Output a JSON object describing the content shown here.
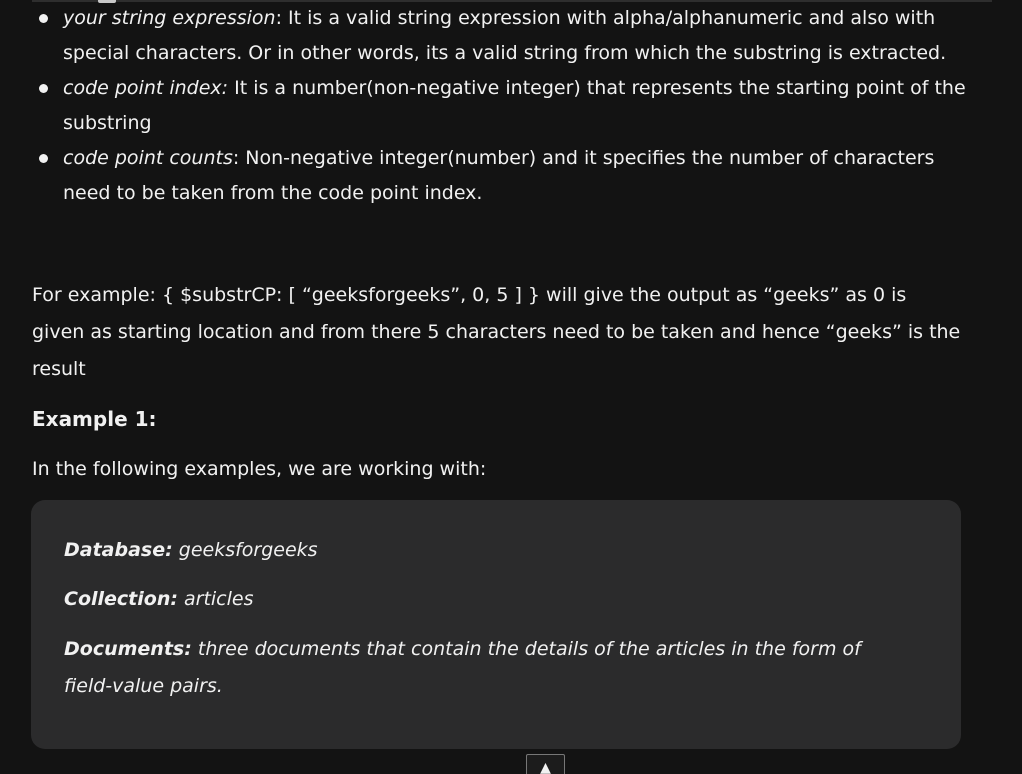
{
  "bullets": [
    {
      "term": "your string expression",
      "text": ": It is a valid string expression with alpha/alphanumeric and also with special characters. Or in other words, its a valid string from which the substring is extracted."
    },
    {
      "term": "code point index:",
      "text": " It is a number(non-negative integer) that represents the starting point of the substring"
    },
    {
      "term": "code point counts",
      "text": ": Non-negative integer(number) and it specifies the number of characters need to be taken from the code point index."
    }
  ],
  "example_paragraph": "For example: { $substrCP: [ “geeksforgeeks”, 0, 5 ] } will give the output as “geeks” as 0 is given as starting location and from there 5 characters need to be taken and hence “geeks” is the result",
  "example_heading": "Example 1:",
  "intro_text": "In the following examples, we are working with:",
  "info_box": {
    "database_label": "Database:",
    "database_value": " geeksforgeeks",
    "collection_label": "Collection:",
    "collection_value": " articles",
    "documents_label": "Documents:",
    "documents_value": " three documents that contain the details of the articles in the form of field-value pairs."
  },
  "scroll_top_icon": "chevron-up-icon",
  "scroll_top_glyph": "▲"
}
